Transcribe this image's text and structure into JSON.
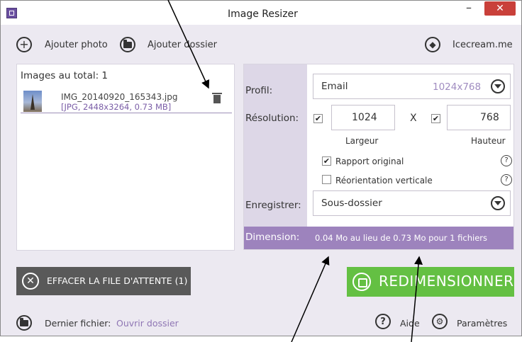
{
  "window": {
    "title": "Image Resizer"
  },
  "titlebar": {
    "minimize": "–",
    "close": "✕"
  },
  "toolbar": {
    "add_photo": "Ajouter photo",
    "add_folder": "Ajouter dossier",
    "brand_link": "Icecream.me"
  },
  "images": {
    "total_label": "Images au total: 1",
    "files": [
      {
        "name": "IMG_20140920_165343.jpg",
        "info": "[JPG, 2448x3264, 0.73 MB]"
      }
    ]
  },
  "settings": {
    "profile_label": "Profil:",
    "profile_value": "Email",
    "profile_size": "1024x768",
    "resolution_label": "Résolution:",
    "width": "1024",
    "x_sep": "X",
    "height": "768",
    "width_label": "Largeur",
    "height_label": "Hauteur",
    "keep_ratio": {
      "label": "Rapport original",
      "checked": true
    },
    "reorient": {
      "label": "Réorientation verticale",
      "checked": false
    },
    "save_label": "Enregistrer:",
    "save_value": "Sous-dossier",
    "dimension_label": "Dimension:",
    "dimension_text": "0.04 Mo au lieu de 0.73 Mo pour 1 fichiers"
  },
  "actions": {
    "clear_queue": "EFFACER LA FILE D'ATTENTE (1)",
    "resize": "REDIMENSIONNER"
  },
  "footer": {
    "last_file_label": "Dernier fichier:",
    "open_folder": "Ouvrir dossier",
    "help": "Aide",
    "settings": "Paramètres"
  },
  "colors": {
    "accent_purple": "#9d83bd",
    "label_bg": "#ddd7e7",
    "resize_green": "#64c043",
    "clear_gray": "#595959",
    "close_red": "#c9403a"
  }
}
